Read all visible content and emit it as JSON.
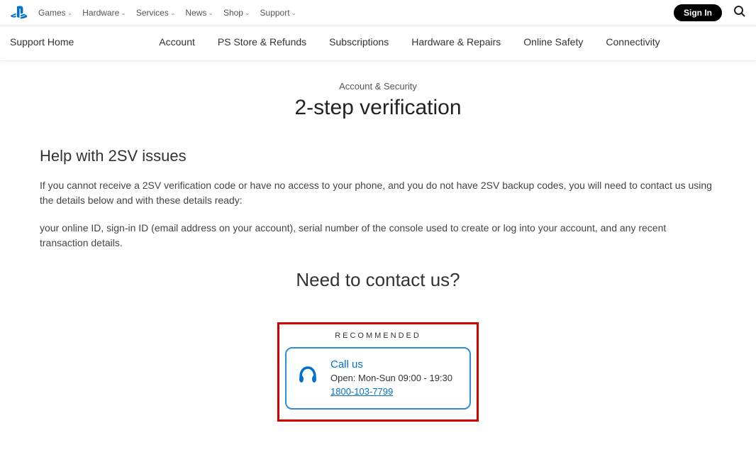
{
  "topNav": {
    "items": [
      "Games",
      "Hardware",
      "Services",
      "News",
      "Shop",
      "Support"
    ],
    "signIn": "Sign In"
  },
  "subNav": {
    "home": "Support Home",
    "items": [
      "Account",
      "PS Store & Refunds",
      "Subscriptions",
      "Hardware & Repairs",
      "Online Safety",
      "Connectivity"
    ]
  },
  "breadcrumb": "Account & Security",
  "pageTitle": "2-step verification",
  "section": {
    "title": "Help with 2SV issues",
    "p1": "If you cannot receive a 2SV verification code or have no access to your phone, and you do not have 2SV backup codes, you will need to contact us using the details below and with these details ready:",
    "p2": "your online ID, sign-in ID (email address on your account), serial number of the console used to create or log into your account, and any recent transaction details."
  },
  "contact": {
    "heading": "Need to contact us?",
    "recommended": "RECOMMENDED",
    "callTitle": "Call us",
    "hours": "Open: Mon-Sun 09:00 - 19:30",
    "phone": "1800-103-7799"
  }
}
